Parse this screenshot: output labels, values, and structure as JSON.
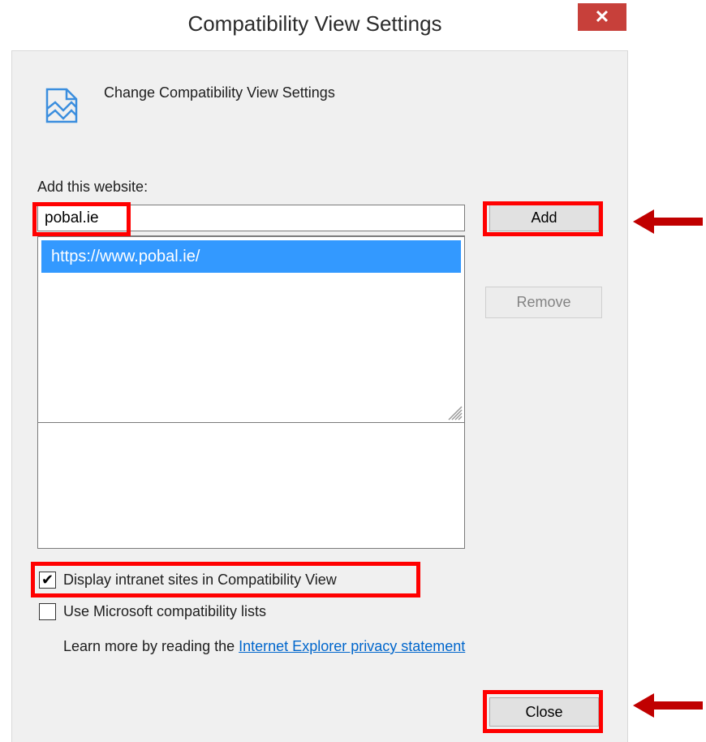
{
  "window": {
    "title": "Compatibility View Settings",
    "close_icon": "close-icon",
    "close_symbol": "✕"
  },
  "header": {
    "icon": "compatibility-view-icon",
    "text": "Change Compatibility View Settings"
  },
  "add_site": {
    "label": "Add this website:",
    "input_value": "pobal.ie",
    "add_button": "Add"
  },
  "autocomplete": {
    "items": [
      "https://www.pobal.ie/"
    ]
  },
  "list": {
    "remove_button": "Remove"
  },
  "options": {
    "intranet": {
      "label": "Display intranet sites in Compatibility View",
      "checked": true
    },
    "ms_lists": {
      "label": "Use Microsoft compatibility lists",
      "checked": false
    },
    "checkmark": "✔"
  },
  "learn_more": {
    "text": "Learn more by reading the ",
    "link": "Internet Explorer privacy statement"
  },
  "footer": {
    "close_button": "Close"
  },
  "annotations": {
    "highlight_color": "#ff0000",
    "arrow_color": "#c00000"
  }
}
